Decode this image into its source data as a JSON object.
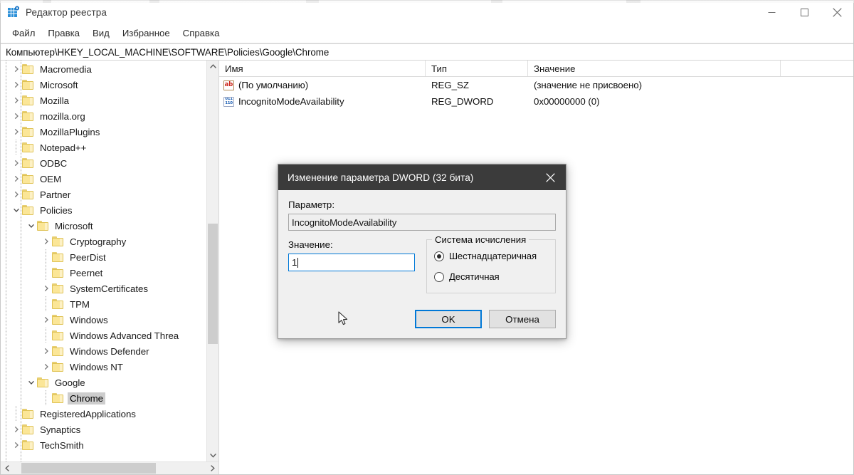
{
  "window": {
    "title": "Редактор реестра",
    "app_icon": "registry-editor-icon",
    "controls": {
      "minimize_label": "—",
      "maximize_label": "□",
      "close_label": "✕"
    }
  },
  "menubar": {
    "items": [
      {
        "label": "Файл"
      },
      {
        "label": "Правка"
      },
      {
        "label": "Вид"
      },
      {
        "label": "Избранное"
      },
      {
        "label": "Справка"
      }
    ]
  },
  "address": {
    "path": "Компьютер\\HKEY_LOCAL_MACHINE\\SOFTWARE\\Policies\\Google\\Chrome"
  },
  "tree": {
    "items": [
      {
        "label": "Macromedia",
        "indent": 1,
        "state": "collapsed",
        "selected": false
      },
      {
        "label": "Microsoft",
        "indent": 1,
        "state": "collapsed",
        "selected": false
      },
      {
        "label": "Mozilla",
        "indent": 1,
        "state": "collapsed",
        "selected": false
      },
      {
        "label": "mozilla.org",
        "indent": 1,
        "state": "collapsed",
        "selected": false
      },
      {
        "label": "MozillaPlugins",
        "indent": 1,
        "state": "collapsed",
        "selected": false
      },
      {
        "label": "Notepad++",
        "indent": 1,
        "state": "leaf",
        "selected": false
      },
      {
        "label": "ODBC",
        "indent": 1,
        "state": "collapsed",
        "selected": false
      },
      {
        "label": "OEM",
        "indent": 1,
        "state": "collapsed",
        "selected": false
      },
      {
        "label": "Partner",
        "indent": 1,
        "state": "collapsed",
        "selected": false
      },
      {
        "label": "Policies",
        "indent": 1,
        "state": "expanded",
        "selected": false
      },
      {
        "label": "Microsoft",
        "indent": 2,
        "state": "expanded",
        "selected": false
      },
      {
        "label": "Cryptography",
        "indent": 3,
        "state": "collapsed",
        "selected": false
      },
      {
        "label": "PeerDist",
        "indent": 3,
        "state": "leaf",
        "selected": false
      },
      {
        "label": "Peernet",
        "indent": 3,
        "state": "leaf",
        "selected": false
      },
      {
        "label": "SystemCertificates",
        "indent": 3,
        "state": "collapsed",
        "selected": false
      },
      {
        "label": "TPM",
        "indent": 3,
        "state": "leaf",
        "selected": false
      },
      {
        "label": "Windows",
        "indent": 3,
        "state": "collapsed",
        "selected": false
      },
      {
        "label": "Windows Advanced Threa",
        "indent": 3,
        "state": "leaf",
        "selected": false
      },
      {
        "label": "Windows Defender",
        "indent": 3,
        "state": "collapsed",
        "selected": false
      },
      {
        "label": "Windows NT",
        "indent": 3,
        "state": "collapsed",
        "selected": false
      },
      {
        "label": "Google",
        "indent": 2,
        "state": "expanded",
        "selected": false
      },
      {
        "label": "Chrome",
        "indent": 3,
        "state": "leaf",
        "selected": true
      },
      {
        "label": "RegisteredApplications",
        "indent": 1,
        "state": "leaf",
        "selected": false
      },
      {
        "label": "Synaptics",
        "indent": 1,
        "state": "collapsed",
        "selected": false
      },
      {
        "label": "TechSmith",
        "indent": 1,
        "state": "collapsed",
        "selected": false
      }
    ]
  },
  "list": {
    "columns": [
      {
        "label": "Имя"
      },
      {
        "label": "Тип"
      },
      {
        "label": "Значение"
      }
    ],
    "rows": [
      {
        "icon": "registry-string-icon",
        "icon_glyph": "ab",
        "name": "(По умолчанию)",
        "type": "REG_SZ",
        "value": "(значение не присвоено)"
      },
      {
        "icon": "registry-dword-icon",
        "icon_glyph_top": "011",
        "icon_glyph_bottom": "110",
        "name": "IncognitoModeAvailability",
        "type": "REG_DWORD",
        "value": "0x00000000 (0)"
      }
    ]
  },
  "dialog": {
    "title": "Изменение параметра DWORD (32 бита)",
    "close_label": "✕",
    "param_label": "Параметр:",
    "param_value": "IncognitoModeAvailability",
    "value_label": "Значение:",
    "value_value": "1",
    "base_group_label": "Система исчисления",
    "radios": [
      {
        "label": "Шестнадцатеричная",
        "checked": true
      },
      {
        "label": "Десятичная",
        "checked": false
      }
    ],
    "ok_label": "OK",
    "cancel_label": "Отмена"
  },
  "colors": {
    "accent": "#0078d7",
    "dialog_titlebar": "#3b3b3b",
    "folder": "#fbe697",
    "selection": "#cdcdcd",
    "dword_icon": "#1d5fb4",
    "string_icon": "#cc2a1e"
  }
}
